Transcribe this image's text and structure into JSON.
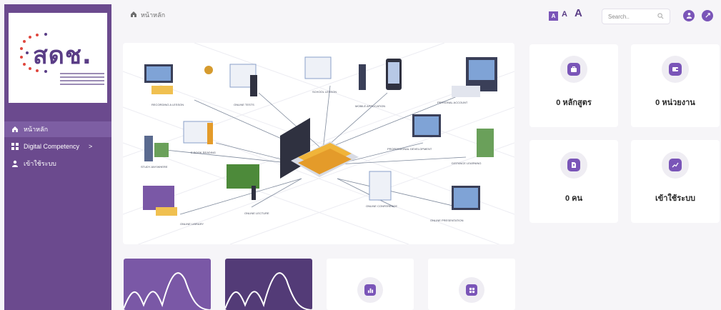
{
  "sidebar": {
    "logo": {
      "text": "สดช."
    },
    "items": [
      {
        "label": "หน้าหลัก",
        "icon": "home-icon",
        "active": true
      },
      {
        "label": "Digital Competency",
        "icon": "grid-icon",
        "active": false,
        "chevron": ">"
      },
      {
        "label": "เข้าใช้ระบบ",
        "icon": "user-icon",
        "active": false
      }
    ]
  },
  "topbar": {
    "breadcrumb": "หน้าหลัก",
    "font_sizes": [
      "A",
      "A",
      "A"
    ],
    "search": {
      "placeholder": "Search.."
    }
  },
  "hero": {
    "labels": [
      "RECORDING A LESSON",
      "ONLINE TESTS",
      "SCHOOL LESSON",
      "MOBILE APPLICATION",
      "PERSONAL ACCOUNT",
      "STUDY ANYWHERE",
      "E-BOOK READING",
      "PROFESSIONAL DEVELOPMENT",
      "DISTANCE LEARNING",
      "ONLINE LIBRARY",
      "ONLINE LECTURE",
      "ONLINE CONFERENCE",
      "ONLINE PRESENTATION"
    ]
  },
  "stats": [
    {
      "label": "0 หลักสูตร",
      "icon": "briefcase-icon"
    },
    {
      "label": "0 หน่วยงาน",
      "icon": "wallet-icon"
    },
    {
      "label": "0 คน",
      "icon": "upload-file-icon"
    },
    {
      "label": "เข้าใช้ระบบ",
      "icon": "trend-chart-icon"
    }
  ],
  "colors": {
    "primary": "#7a55b8",
    "sidebar": "#6b4a8e",
    "active": "#7d5ea3"
  }
}
